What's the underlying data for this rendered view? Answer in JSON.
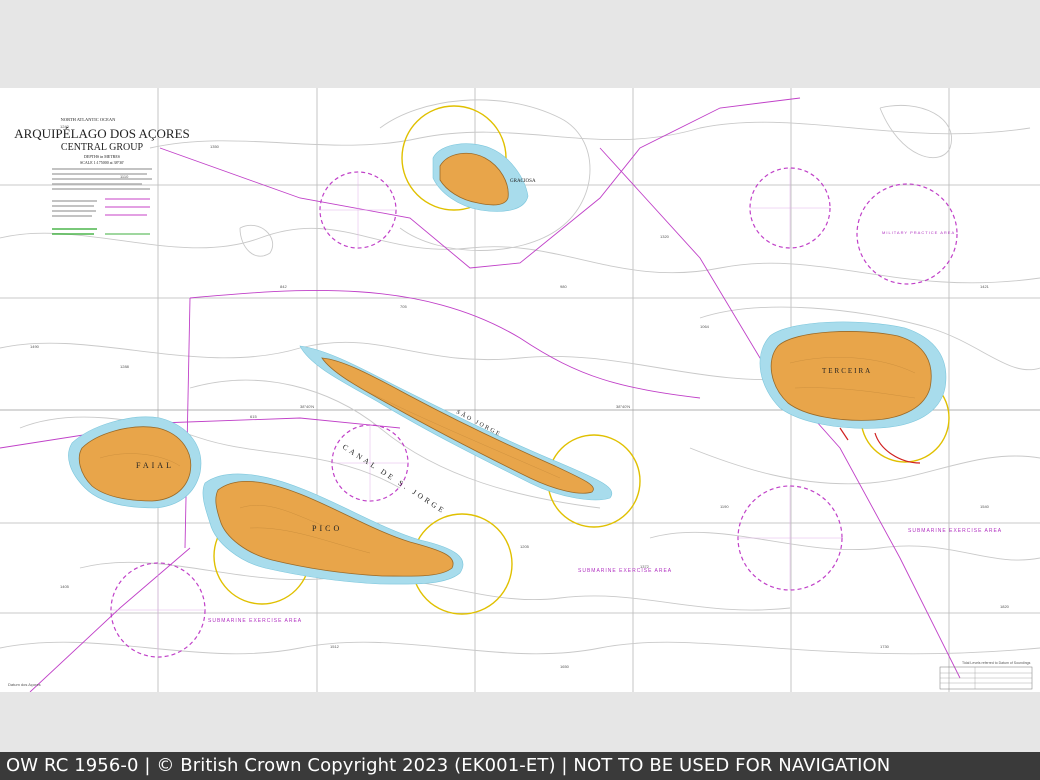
{
  "chart": {
    "ocean_label": "NORTH ATLANTIC OCEAN",
    "title": "ARQUIPÉLAGO DOS AÇORES",
    "subtitle": "CENTRAL GROUP",
    "units": "DEPTHS in METRES",
    "scale": "SCALE 1:175000 at 38°30'",
    "islands": {
      "graciosa": "GRACIOSA",
      "terceira": "TERCEIRA",
      "sao_jorge": "SÃO JORGE",
      "pico": "PICO",
      "faial": "FAIAL"
    },
    "channel_label": "CANAL DE S. JORGE",
    "exercise_areas": [
      "SUBMARINE EXERCISE AREA",
      "SUBMARINE EXERCISE AREA",
      "SUBMARINE EXERCISE AREA"
    ],
    "military_label": "MILITARY PRACTICE AREA",
    "tidal_table_title": "Tidal Levels referred to Datum of Soundings",
    "corner_note": "Datum dos Açores",
    "lat_labels": [
      "38°40'N",
      "38°40'N"
    ],
    "colors": {
      "land": "#e8a54a",
      "shallow": "#a8dcec",
      "magenta": "#c040c8",
      "yellow_circle": "#e0c000"
    }
  },
  "footer": {
    "caption": "OW RC 1956-0 | © British Crown Copyright 2023 (EK001-ET) | NOT TO BE USED FOR NAVIGATION"
  }
}
